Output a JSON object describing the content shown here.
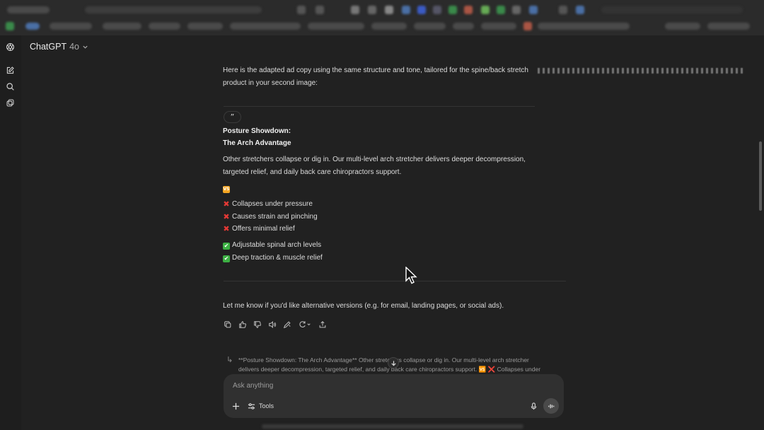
{
  "header": {
    "model_name": "ChatGPT",
    "model_version": "4o"
  },
  "sidebar": {
    "icons": [
      "chatgpt-logo-icon",
      "new-chat-icon",
      "search-icon",
      "library-icon"
    ]
  },
  "message": {
    "intro": "Here is the adapted ad copy using the same structure and tone, tailored for the spine/back stretch",
    "intro_line2": "product in your second image:",
    "quote_glyph": "”",
    "headline1": "Posture Showdown:",
    "headline2": "The Arch Advantage",
    "body_line1": "Other stretchers collapse or dig in. Our multi-level arch stretcher delivers deeper decompression,",
    "body_line2": "targeted relief, and daily back care chiropractors support.",
    "vs_emoji": "VS",
    "cons": [
      "Collapses under pressure",
      "Causes strain and pinching",
      "Offers minimal relief"
    ],
    "pros": [
      "Adjustable spinal arch levels",
      "Deep traction & muscle relief"
    ],
    "x_glyph": "✖",
    "check_glyph": "✔",
    "closing": "Let me know if you'd like alternative versions (e.g. for email, landing pages, or social ads)."
  },
  "actions": [
    "copy-icon",
    "thumbs-up-icon",
    "thumbs-down-icon",
    "read-aloud-icon",
    "edit-icon",
    "regenerate-icon",
    "share-icon"
  ],
  "suggestion": {
    "arrow": "↳",
    "line1": "**Posture Showdown: The Arch Advantage** Other stretchers collapse or dig in. Our multi-level arch stretcher",
    "line2": "delivers deeper decompression, targeted relief, and daily back care chiropractors support. 🆚 ❌ Collapses under"
  },
  "composer": {
    "placeholder": "Ask anything",
    "tools_label": "Tools"
  },
  "colors": {
    "background": "#212121",
    "sidebar": "#1e1e1e",
    "composer": "#303030",
    "check_green": "#3cb043",
    "cross_red": "#e53935",
    "vs_orange": "#f5a623"
  }
}
